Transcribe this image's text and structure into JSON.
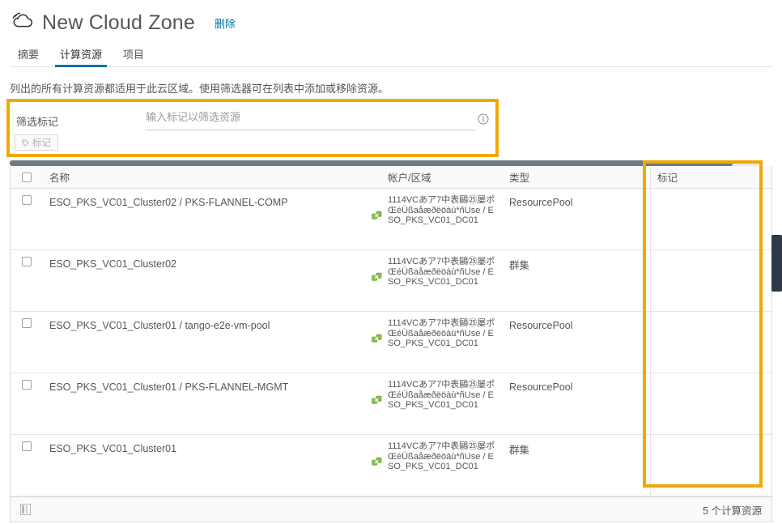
{
  "header": {
    "icon": "cloud-icon",
    "title": "New Cloud Zone",
    "delete_label": "删除"
  },
  "tabs": [
    {
      "label": "摘要",
      "active": false
    },
    {
      "label": "计算资源",
      "active": true
    },
    {
      "label": "项目",
      "active": false
    }
  ],
  "description": "列出的所有计算资源都适用于此云区域。使用筛选器可在列表中添加或移除资源。",
  "filter": {
    "label": "筛选标记",
    "placeholder": "输入标记以筛选资源",
    "value": "",
    "info_icon": "info-icon",
    "chip_label": "标记",
    "chip_icon": "tag-icon",
    "highlight_color": "#f0a800"
  },
  "grid": {
    "columns": {
      "name": "名称",
      "account_region": "帐户/区域",
      "type": "类型",
      "tags": "标记"
    },
    "rows": [
      {
        "name": "ESO_PKS_VC01_Cluster02 / PKS-FLANNEL-COMP",
        "acct_line1": "1114VCあア7中表鷗㉕屡ポ",
        "acct_line2": "ŒéÜßaåæðëöàù*ñUse / ESO_PKS_VC01_DC01",
        "type": "ResourcePool",
        "tags": ""
      },
      {
        "name": "ESO_PKS_VC01_Cluster02",
        "acct_line1": "1114VCあア7中表鷗㉕屡ポ",
        "acct_line2": "ŒéÜßaåæðëöàù*ñUse / ESO_PKS_VC01_DC01",
        "type": "群集",
        "tags": ""
      },
      {
        "name": "ESO_PKS_VC01_Cluster01 / tango-e2e-vm-pool",
        "acct_line1": "1114VCあア7中表鷗㉕屡ポ",
        "acct_line2": "ŒéÜßaåæðëöàù*ñUse / ESO_PKS_VC01_DC01",
        "type": "ResourcePool",
        "tags": ""
      },
      {
        "name": "ESO_PKS_VC01_Cluster01 / PKS-FLANNEL-MGMT",
        "acct_line1": "1114VCあア7中表鷗㉕屡ポ",
        "acct_line2": "ŒéÜßaåæðëöàù*ñUse / ESO_PKS_VC01_DC01",
        "type": "ResourcePool",
        "tags": ""
      },
      {
        "name": "ESO_PKS_VC01_Cluster01",
        "acct_line1": "1114VCあア7中表鷗㉕屡ポ",
        "acct_line2": "ŒéÜßaåæðëöàù*ñUse / ESO_PKS_VC01_DC01",
        "type": "群集",
        "tags": ""
      }
    ],
    "footer": {
      "column_picker_icon": "columns-icon",
      "count_text": "5 个计算资源"
    },
    "tags_highlight_color": "#f0a800"
  },
  "theme": {
    "accent": "#0072a3",
    "text": "#565656",
    "highlight": "#f0a800",
    "link_icon": "#7cb342"
  }
}
